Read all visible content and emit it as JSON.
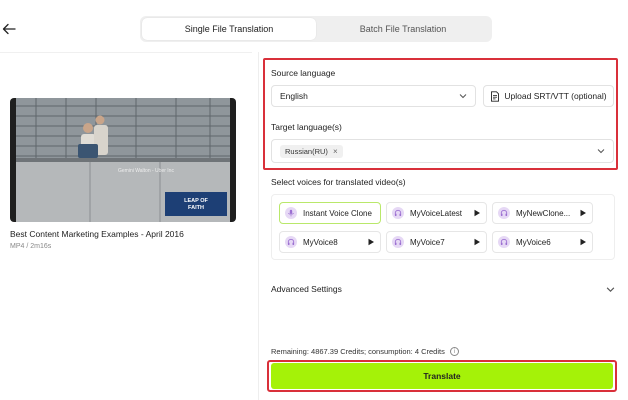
{
  "tabs": [
    {
      "label": "Single File Translation",
      "active": true
    },
    {
      "label": "Batch File Translation",
      "active": false
    }
  ],
  "video": {
    "title": "Best Content Marketing Examples - April 2016",
    "meta": "MP4 / 2m16s"
  },
  "source": {
    "label": "Source language",
    "value": "English",
    "upload_label": "Upload SRT/VTT (optional)"
  },
  "target": {
    "label": "Target language(s)",
    "chips": [
      "Russian(RU)"
    ]
  },
  "voices": {
    "label": "Select voices for translated video(s)",
    "items": [
      {
        "name": "Instant Voice Clone",
        "icon": "mic-icon",
        "selected": true
      },
      {
        "name": "MyVoiceLatest",
        "icon": "headphones-icon",
        "selected": false
      },
      {
        "name": "MyNewClone...",
        "icon": "headphones-icon",
        "selected": false
      },
      {
        "name": "MyVoice8",
        "icon": "headphones-icon",
        "selected": false
      },
      {
        "name": "MyVoice7",
        "icon": "headphones-icon",
        "selected": false
      },
      {
        "name": "MyVoice6",
        "icon": "headphones-icon",
        "selected": false
      }
    ]
  },
  "advanced": {
    "label": "Advanced Settings"
  },
  "credits": {
    "text": "Remaining: 4867.39 Credits; consumption: 4 Credits"
  },
  "translate": {
    "label": "Translate"
  },
  "colors": {
    "accent": "#a5f208",
    "highlight": "#d9303a",
    "avatar": "#e6d8f5"
  }
}
